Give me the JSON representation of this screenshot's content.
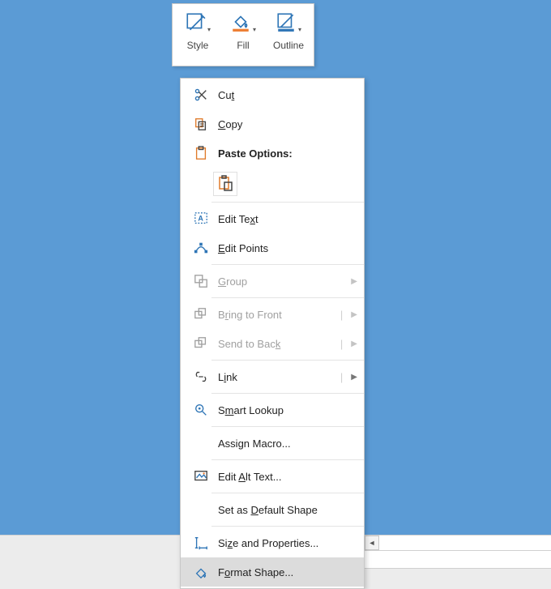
{
  "toolbar": {
    "style_label": "Style",
    "fill_label": "Fill",
    "outline_label": "Outline"
  },
  "menu": {
    "cut": "Cut",
    "copy": "Copy",
    "paste_options": "Paste Options:",
    "edit_text": "Edit Text",
    "edit_points": "Edit Points",
    "group": "Group",
    "bring_to_front": "Bring to Front",
    "send_to_back": "Send to Back",
    "link": "Link",
    "smart_lookup": "Smart Lookup",
    "assign_macro": "Assign Macro...",
    "edit_alt_text": "Edit Alt Text...",
    "set_as_default_shape": "Set as Default Shape",
    "size_and_properties": "Size and Properties...",
    "format_shape": "Format Shape..."
  }
}
